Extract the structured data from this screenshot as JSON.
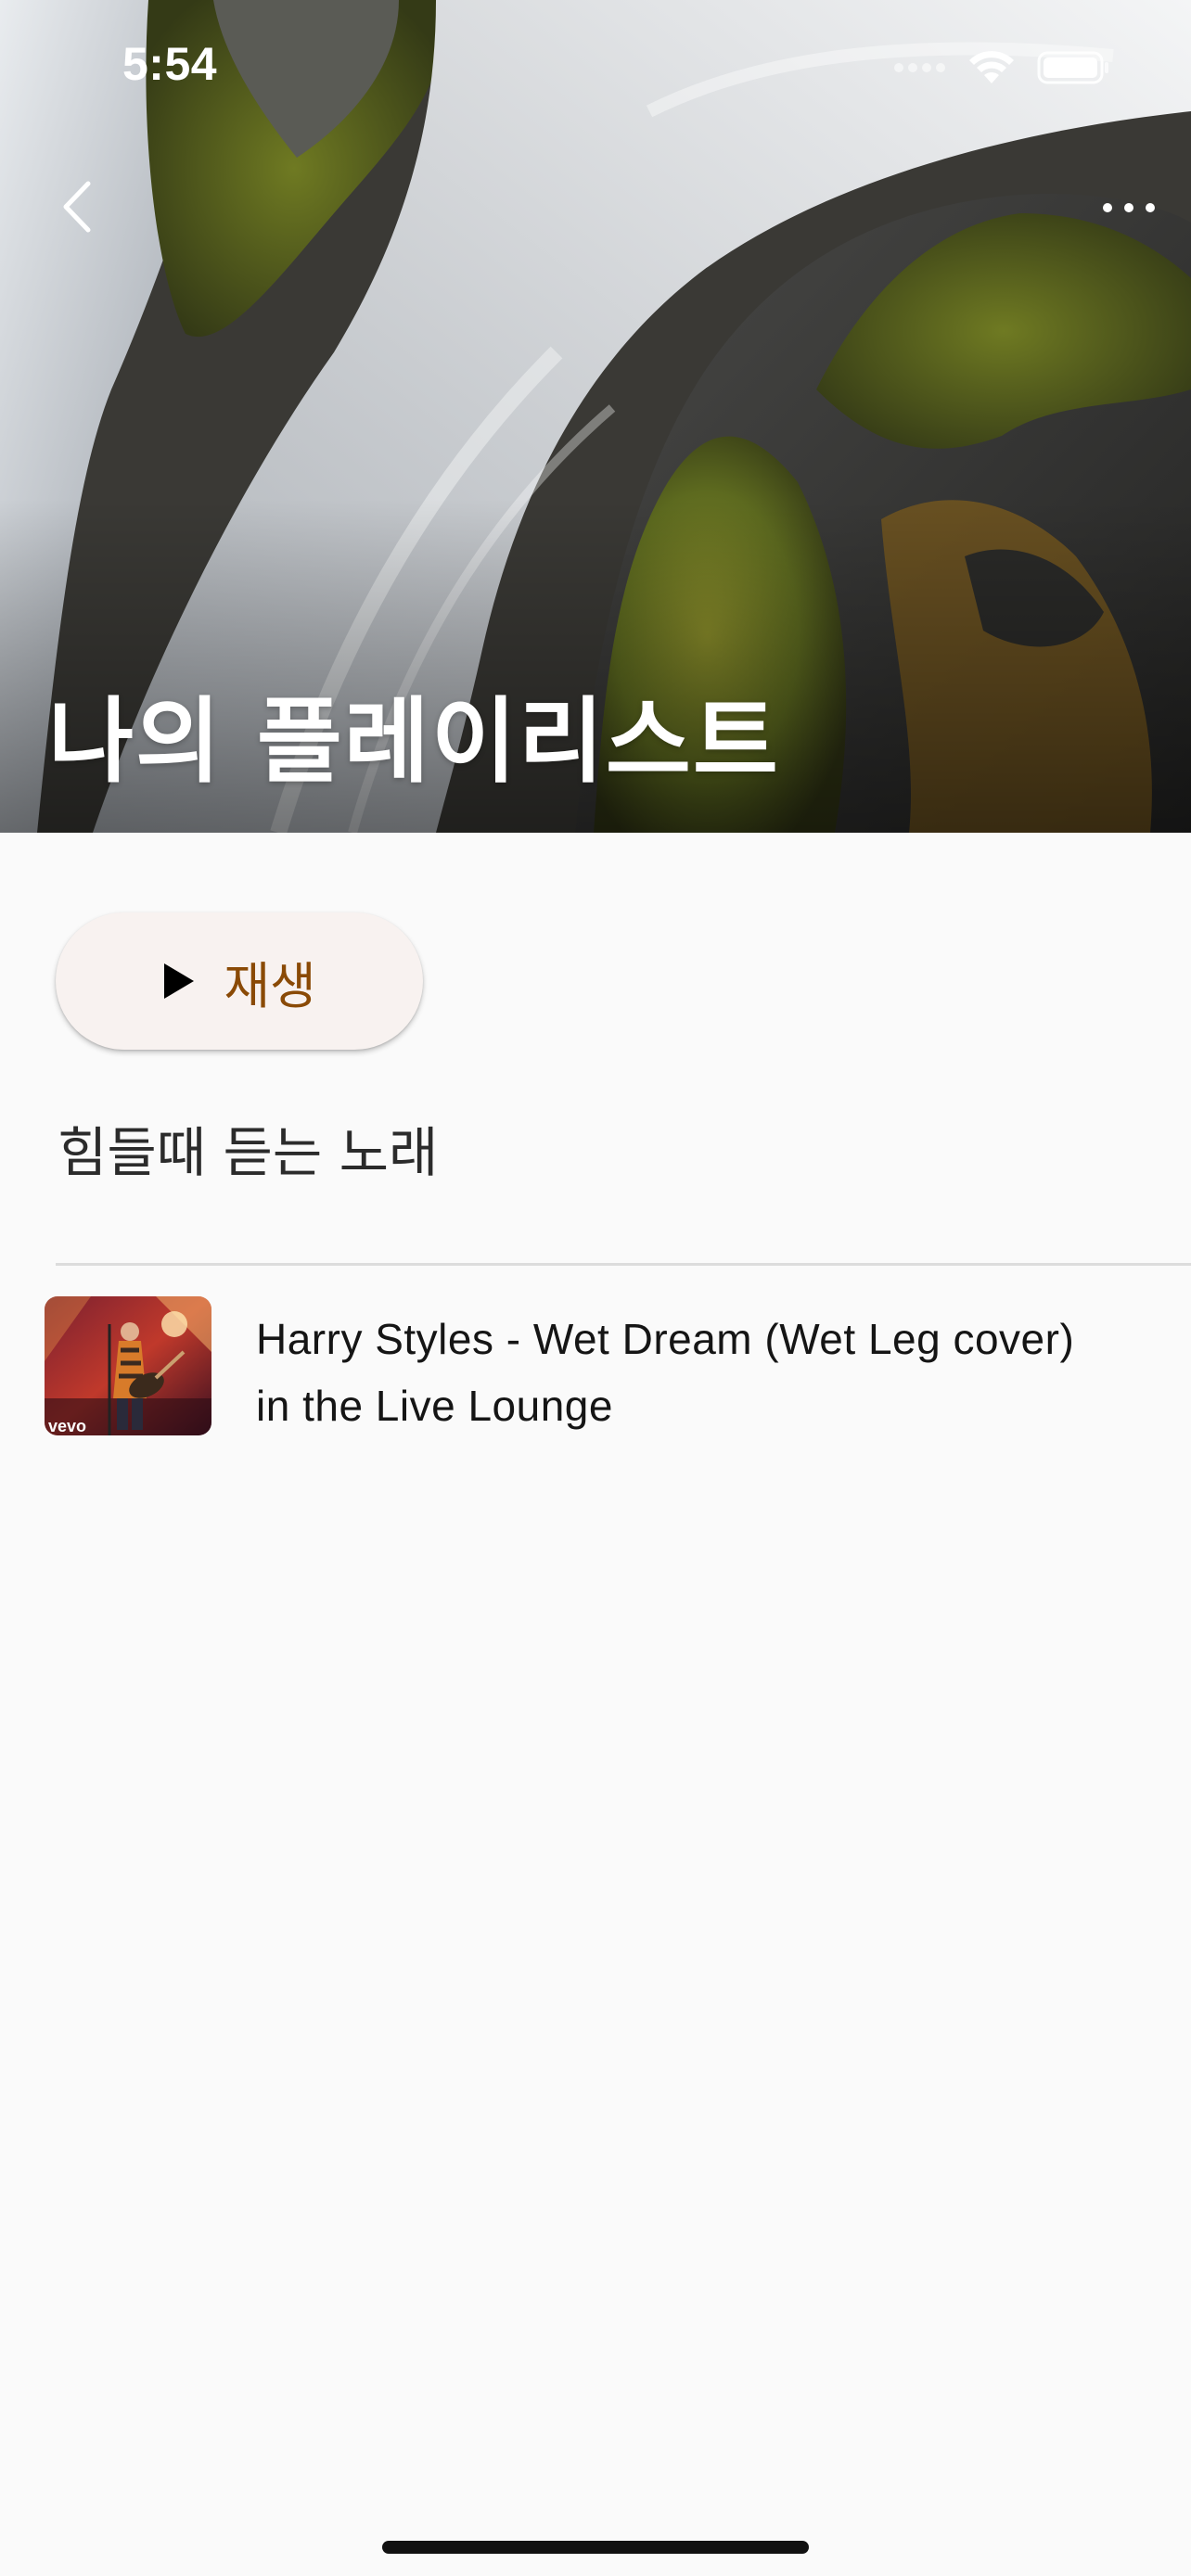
{
  "status_bar": {
    "time": "5:54"
  },
  "header": {
    "title": "나의 플레이리스트",
    "back_icon": "chevron-left-icon",
    "more_icon": "ellipsis-horizontal-icon"
  },
  "actions": {
    "play_label": "재생",
    "play_icon": "play-triangle-icon",
    "accent_color": "#8a4a06"
  },
  "playlist": {
    "description": "힘들때 듣는 노래"
  },
  "tracks": [
    {
      "title": "Harry Styles - Wet Dream (Wet Leg cover) in the Live Lounge",
      "thumb_badge": "vevo"
    }
  ]
}
